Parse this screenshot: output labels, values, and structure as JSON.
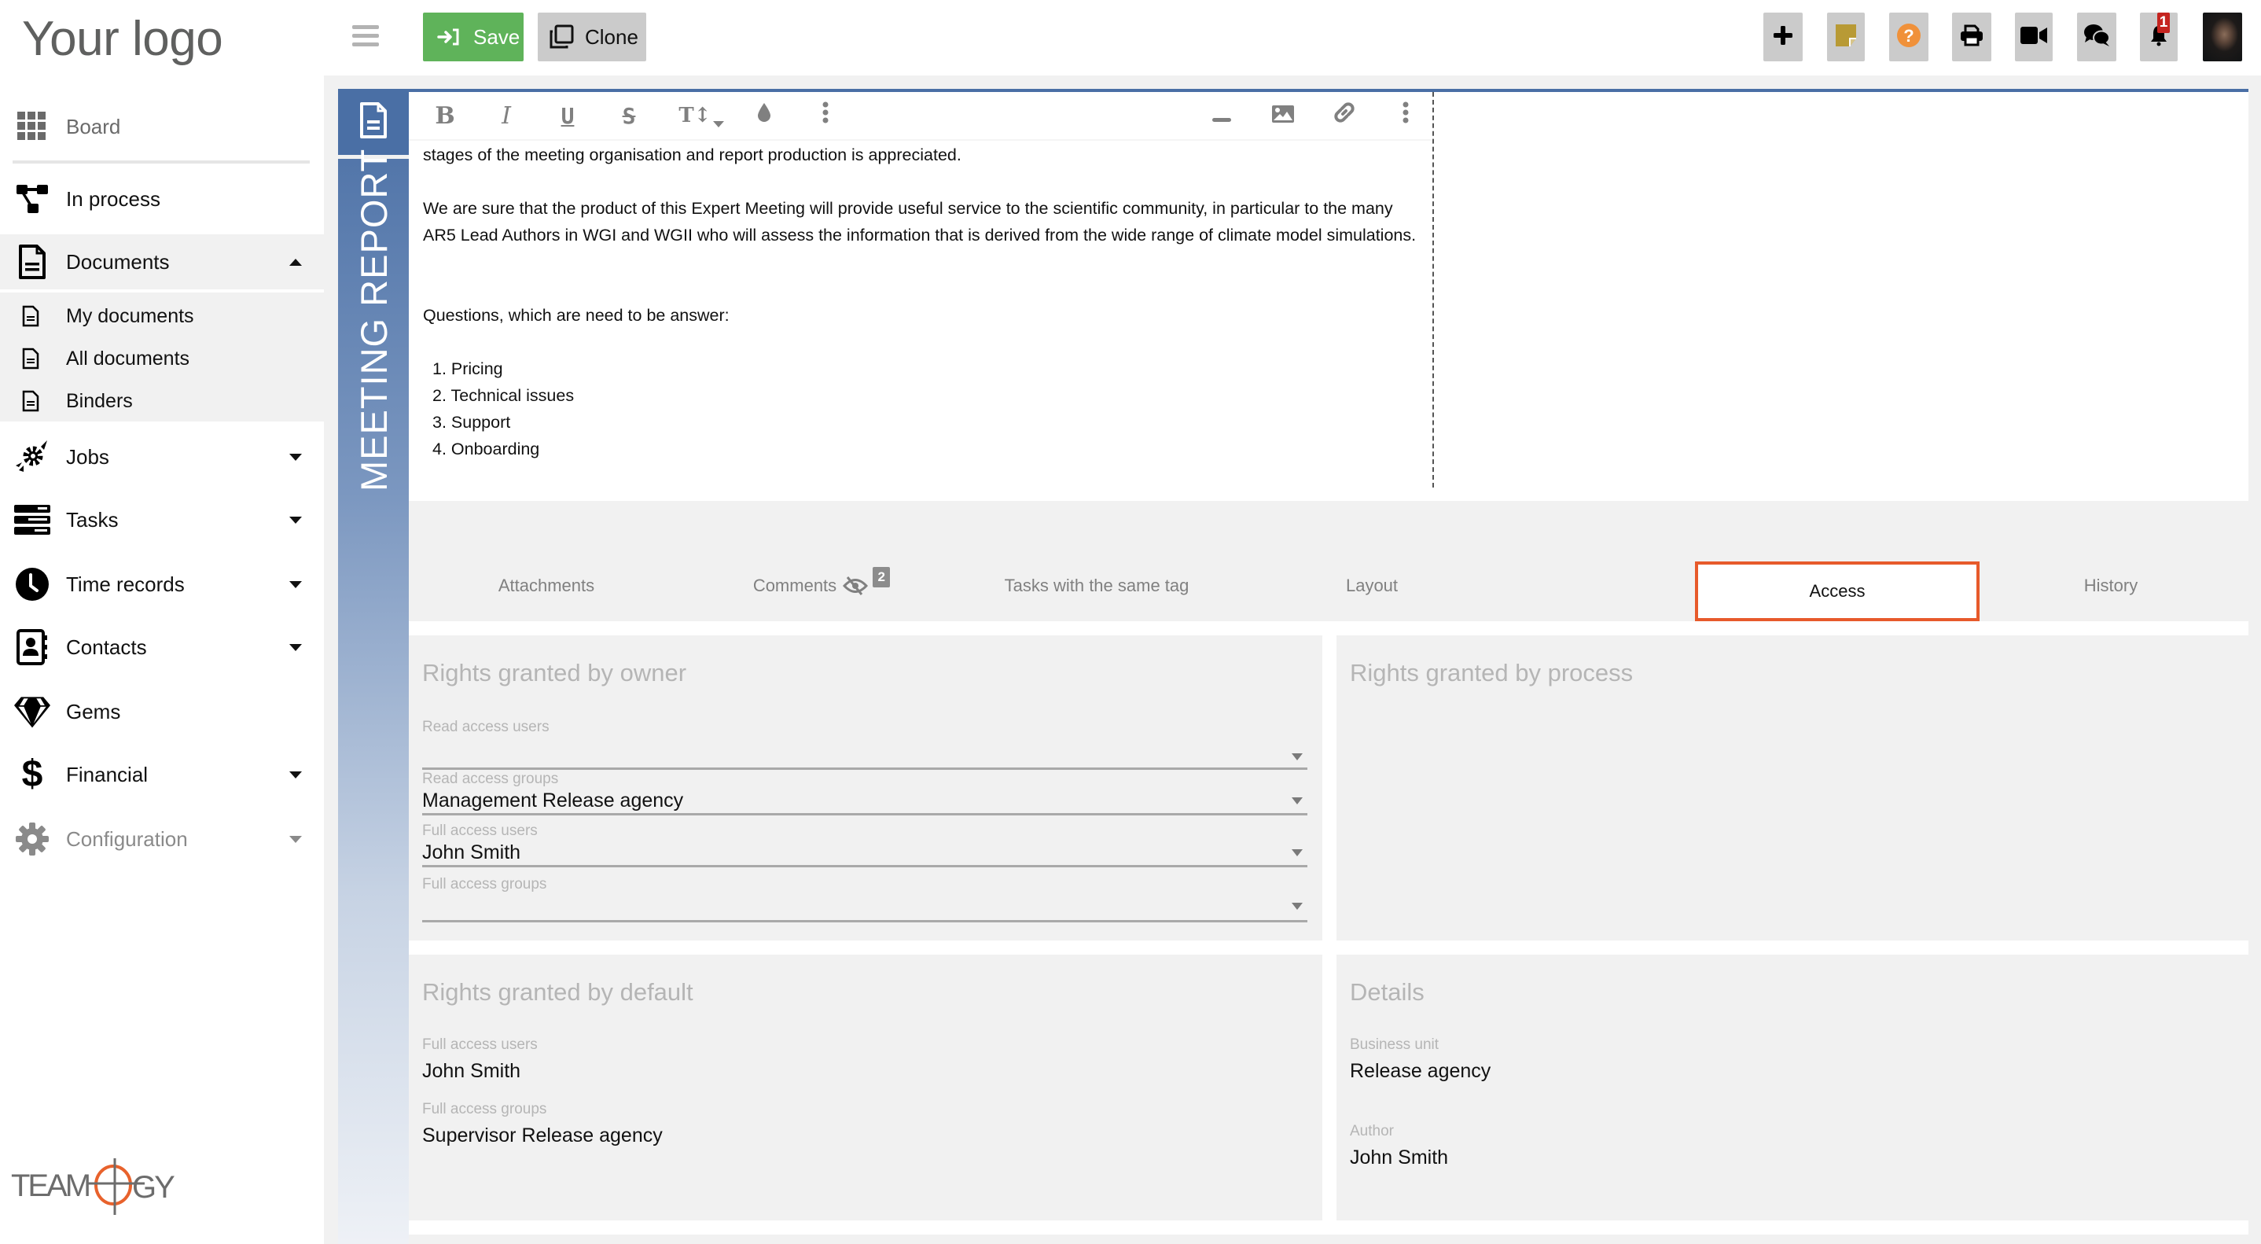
{
  "logo": {
    "text": "Your logo",
    "brand": "TEAMOGY"
  },
  "sidebar": {
    "items": [
      {
        "label": "Board",
        "icon": "grid-icon"
      },
      {
        "label": "In process",
        "icon": "process-icon"
      },
      {
        "label": "Documents",
        "icon": "document-icon",
        "expanded": true
      },
      {
        "label": "Jobs",
        "icon": "jobs-icon"
      },
      {
        "label": "Tasks",
        "icon": "tasks-icon"
      },
      {
        "label": "Time records",
        "icon": "clock-icon"
      },
      {
        "label": "Contacts",
        "icon": "contacts-icon"
      },
      {
        "label": "Gems",
        "icon": "gem-icon"
      },
      {
        "label": "Financial",
        "icon": "dollar-icon"
      },
      {
        "label": "Configuration",
        "icon": "gear-icon"
      }
    ],
    "documents_sub": [
      {
        "label": "My documents"
      },
      {
        "label": "All documents"
      },
      {
        "label": "Binders"
      }
    ]
  },
  "toolbar": {
    "save_label": "Save",
    "clone_label": "Clone",
    "notification_count": "1",
    "icons": [
      "plus-icon",
      "sticky-note-icon",
      "help-icon",
      "print-icon",
      "video-icon",
      "chat-icon",
      "bell-icon"
    ]
  },
  "colors": {
    "accent_blue": "#4a6fa5",
    "save_green": "#5fb35a",
    "active_tab_border": "#e75a2b",
    "badge_red": "#c5241f",
    "help_orange": "#f0913a",
    "note_gold": "#b89a35"
  },
  "document": {
    "type_label": "MEETING REPORT",
    "editor_toolbar": [
      "bold",
      "italic",
      "underline",
      "strikethrough",
      "font-size",
      "color",
      "more",
      "horizontal-rule",
      "image",
      "link",
      "more"
    ],
    "content": {
      "p1": "stages of the meeting organisation and report production is appreciated.",
      "p2": "We are sure that the product of this Expert Meeting will provide useful service to the scientific community, in particular to the many AR5 Lead Authors in WGI and WGII who will assess the information that is derived from the wide range of climate model simulations.",
      "p3": "Questions, which are need to be answer:",
      "list": [
        "1. Pricing",
        "2. Technical issues",
        "3. Support",
        "4. Onboarding"
      ]
    }
  },
  "tabs": [
    {
      "label": "Attachments"
    },
    {
      "label": "Comments",
      "count": "2"
    },
    {
      "label": "Tasks with the same tag"
    },
    {
      "label": "Layout"
    },
    {
      "label": "Access",
      "active": true
    },
    {
      "label": "History"
    }
  ],
  "access": {
    "owner": {
      "title": "Rights granted by owner",
      "fields": [
        {
          "label": "Read access users",
          "value": ""
        },
        {
          "label": "Read access groups",
          "value": "Management Release agency"
        },
        {
          "label": "Full access users",
          "value": "John Smith"
        },
        {
          "label": "Full access groups",
          "value": ""
        }
      ]
    },
    "process": {
      "title": "Rights granted by process"
    },
    "default": {
      "title": "Rights granted by default",
      "fields": [
        {
          "label": "Full access users",
          "value": "John Smith"
        },
        {
          "label": "Full access groups",
          "value": "Supervisor Release agency"
        }
      ]
    },
    "details": {
      "title": "Details",
      "fields": [
        {
          "label": "Business unit",
          "value": "Release agency"
        },
        {
          "label": "Author",
          "value": "John Smith"
        }
      ]
    }
  }
}
